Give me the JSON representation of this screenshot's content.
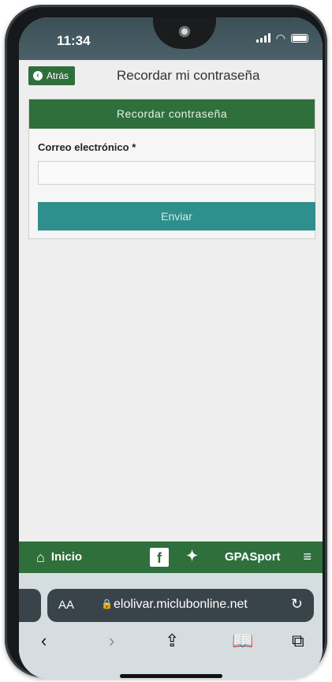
{
  "status": {
    "time": "11:34"
  },
  "header": {
    "back_label": "Atrás",
    "title": "Recordar mi contraseña"
  },
  "form": {
    "heading": "Recordar contraseña",
    "email_label": "Correo electrónico *",
    "email_value": "",
    "submit_label": "Enviar"
  },
  "sitenav": {
    "home_label": "Inicio",
    "brand_label": "GPASport"
  },
  "browser": {
    "text_size_label": "AA",
    "url": "elolivar.miclubonline.net"
  },
  "colors": {
    "primary_green": "#2f6f3c",
    "teal_button": "#2f8f8c",
    "page_bg": "#eeeeee"
  },
  "icons": [
    "back-icon",
    "home-icon",
    "facebook-icon",
    "twitter-icon",
    "menu-icon",
    "lock-icon",
    "reload-icon",
    "back-nav-icon",
    "forward-nav-icon",
    "share-icon",
    "bookmarks-icon",
    "tabs-icon"
  ]
}
